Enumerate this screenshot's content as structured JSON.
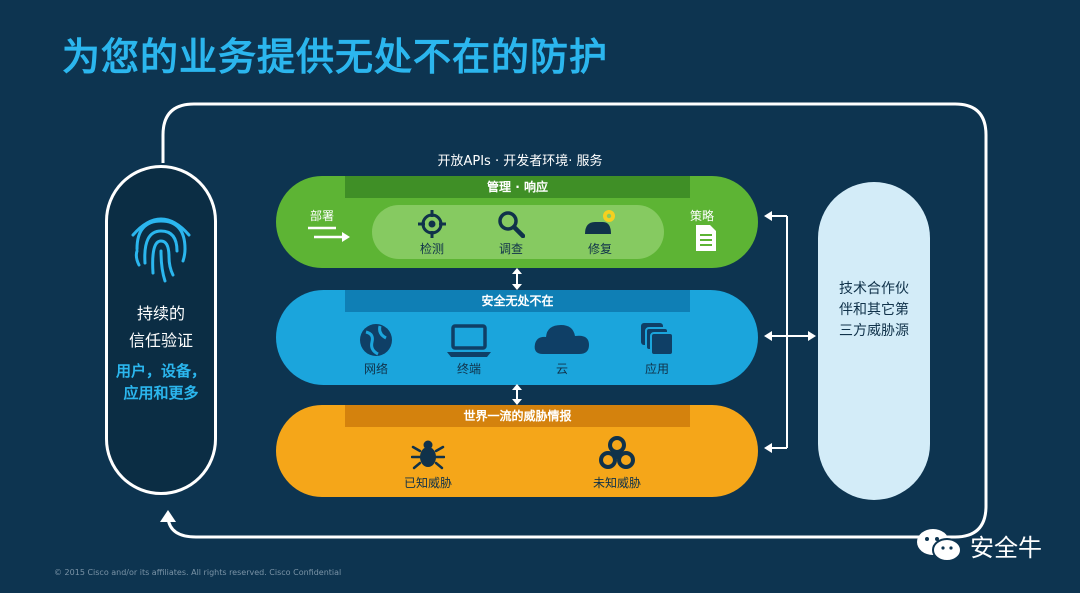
{
  "title": "为您的业务提供无处不在的防护",
  "trust": {
    "line1": "持续的",
    "line2": "信任验证",
    "line3": "用户，设备，",
    "line4": "应用和更多",
    "icon": "fingerprint-icon"
  },
  "top_label": "开放APIs · 开发者环境· 服务",
  "green_band": {
    "tab": "管理 · 响应",
    "left_label": "部署",
    "items": [
      {
        "label": "检测",
        "icon": "crosshair-icon"
      },
      {
        "label": "调查",
        "icon": "magnifier-icon"
      },
      {
        "label": "修复",
        "icon": "repair-icon"
      }
    ],
    "right_label": "策略",
    "right_icon": "document-icon"
  },
  "blue_band": {
    "tab": "安全无处不在",
    "items": [
      {
        "label": "网络",
        "icon": "globe-icon"
      },
      {
        "label": "终端",
        "icon": "laptop-icon"
      },
      {
        "label": "云",
        "icon": "cloud-icon"
      },
      {
        "label": "应用",
        "icon": "apps-icon"
      }
    ]
  },
  "orange_band": {
    "tab": "世界一流的威胁情报",
    "items": [
      {
        "label": "已知威胁",
        "icon": "bug-icon"
      },
      {
        "label": "未知威胁",
        "icon": "biohazard-icon"
      }
    ]
  },
  "side_panel": {
    "line1": "技术合作伙",
    "line2": "伴和其它第",
    "line3": "三方威胁源"
  },
  "footer": "© 2015  Cisco and/or its affiliates. All rights reserved.    Cisco Confidential",
  "brand": "安全牛",
  "colors": {
    "background": "#0d3450",
    "title": "#2bb6ee",
    "green": "#5db434",
    "blue": "#1ba5dc",
    "orange": "#f5a619",
    "side_panel": "#d3ecf8"
  }
}
